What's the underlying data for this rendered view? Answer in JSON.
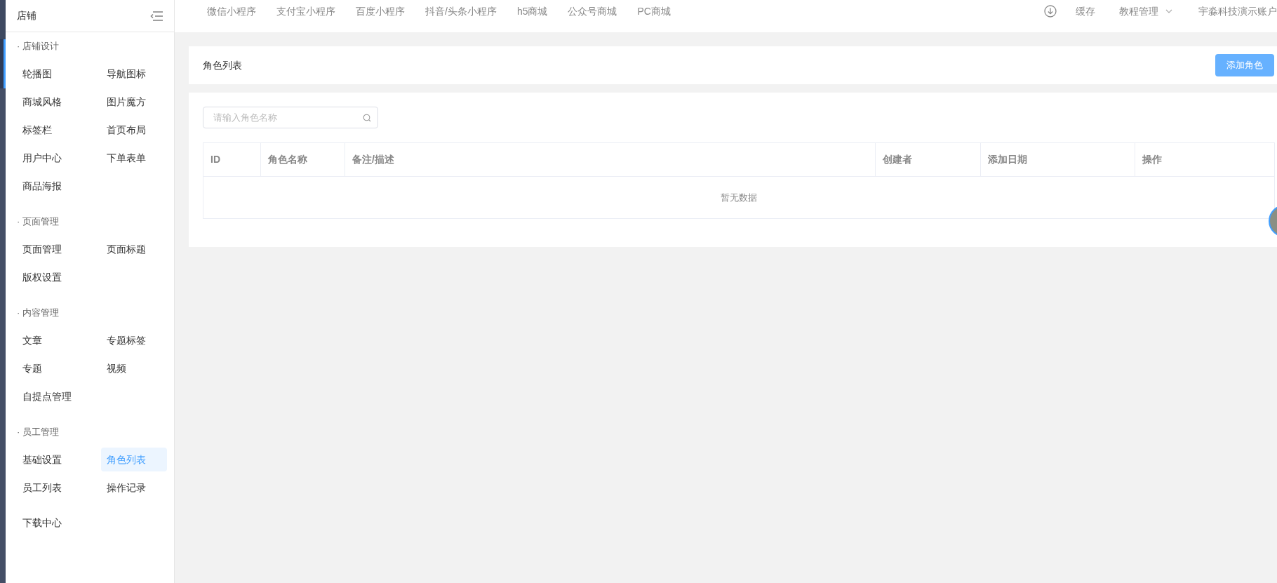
{
  "sidebar": {
    "title": "店铺",
    "sections": [
      {
        "title": "· 店铺设计",
        "items": [
          {
            "label": "轮播图",
            "selected": false
          },
          {
            "label": "导航图标",
            "selected": false
          },
          {
            "label": "商城风格",
            "selected": false
          },
          {
            "label": "图片魔方",
            "selected": false
          },
          {
            "label": "标签栏",
            "selected": false
          },
          {
            "label": "首页布局",
            "selected": false
          },
          {
            "label": "用户中心",
            "selected": false
          },
          {
            "label": "下单表单",
            "selected": false
          },
          {
            "label": "商品海报",
            "selected": false
          }
        ]
      },
      {
        "title": "· 页面管理",
        "items": [
          {
            "label": "页面管理",
            "selected": false
          },
          {
            "label": "页面标题",
            "selected": false
          },
          {
            "label": "版权设置",
            "selected": false
          }
        ]
      },
      {
        "title": "· 内容管理",
        "items": [
          {
            "label": "文章",
            "selected": false
          },
          {
            "label": "专题标签",
            "selected": false
          },
          {
            "label": "专题",
            "selected": false
          },
          {
            "label": "视频",
            "selected": false
          },
          {
            "label": "自提点管理",
            "selected": false
          }
        ]
      },
      {
        "title": "· 员工管理",
        "items": [
          {
            "label": "基础设置",
            "selected": false
          },
          {
            "label": "角色列表",
            "selected": true
          },
          {
            "label": "员工列表",
            "selected": false
          },
          {
            "label": "操作记录",
            "selected": false
          }
        ]
      }
    ],
    "footer_items": [
      {
        "label": "下载中心",
        "selected": false
      }
    ]
  },
  "top_nav": {
    "items": [
      "微信小程序",
      "支付宝小程序",
      "百度小程序",
      "抖音/头条小程序",
      "h5商城",
      "公众号商城",
      "PC商城"
    ],
    "cache": "缓存",
    "tutorial_menu": "教程管理",
    "account": "宇淼科技演示账户"
  },
  "page": {
    "title": "角色列表",
    "add_button": "添加角色"
  },
  "search": {
    "placeholder": "请输入角色名称"
  },
  "table": {
    "columns": [
      "ID",
      "角色名称",
      "备注/描述",
      "创建者",
      "添加日期",
      "操作"
    ],
    "empty_text": "暂无数据"
  }
}
